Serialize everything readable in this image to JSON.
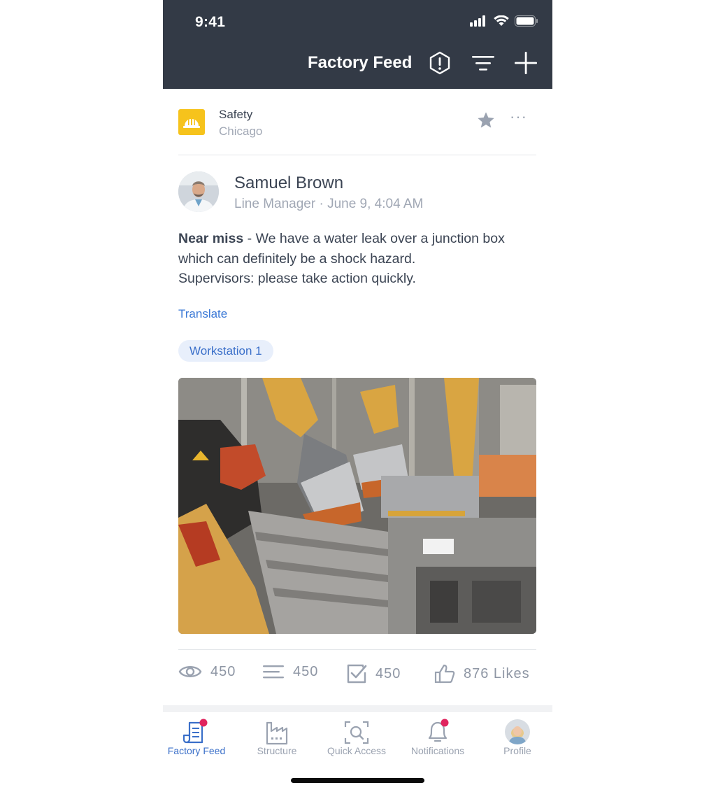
{
  "status_bar": {
    "time": "9:41"
  },
  "header": {
    "title": "Factory Feed",
    "icons": [
      "alert-icon",
      "filter-icon",
      "add-icon"
    ]
  },
  "channel": {
    "name": "Safety",
    "location": "Chicago",
    "logo_color": "#f6c31c"
  },
  "post": {
    "author": "Samuel Brown",
    "meta": "Line Manager · June 9, 4:04 AM",
    "body_bold": "Near miss",
    "body_rest": " - We have a water leak over a junction box which can definitely be a shock hazard.",
    "body_line2": "Supervisors: please take action quickly.",
    "translate": "Translate",
    "tag": "Workstation 1",
    "stats": {
      "views": "450",
      "comments": "450",
      "tasks": "450",
      "likes": "876 Likes"
    }
  },
  "tabbar": {
    "items": [
      {
        "label": "Factory Feed",
        "icon": "feed-icon",
        "active": true,
        "badge": true
      },
      {
        "label": "Structure",
        "icon": "factory-icon",
        "active": false,
        "badge": false
      },
      {
        "label": "Quick Access",
        "icon": "scan-icon",
        "active": false,
        "badge": false
      },
      {
        "label": "Notifications",
        "icon": "bell-icon",
        "active": false,
        "badge": true
      },
      {
        "label": "Profile",
        "icon": "profile-avatar",
        "active": false,
        "badge": false
      }
    ]
  },
  "colors": {
    "header_bg": "#333a46",
    "accent": "#3a6fc9",
    "badge": "#e0245e"
  }
}
